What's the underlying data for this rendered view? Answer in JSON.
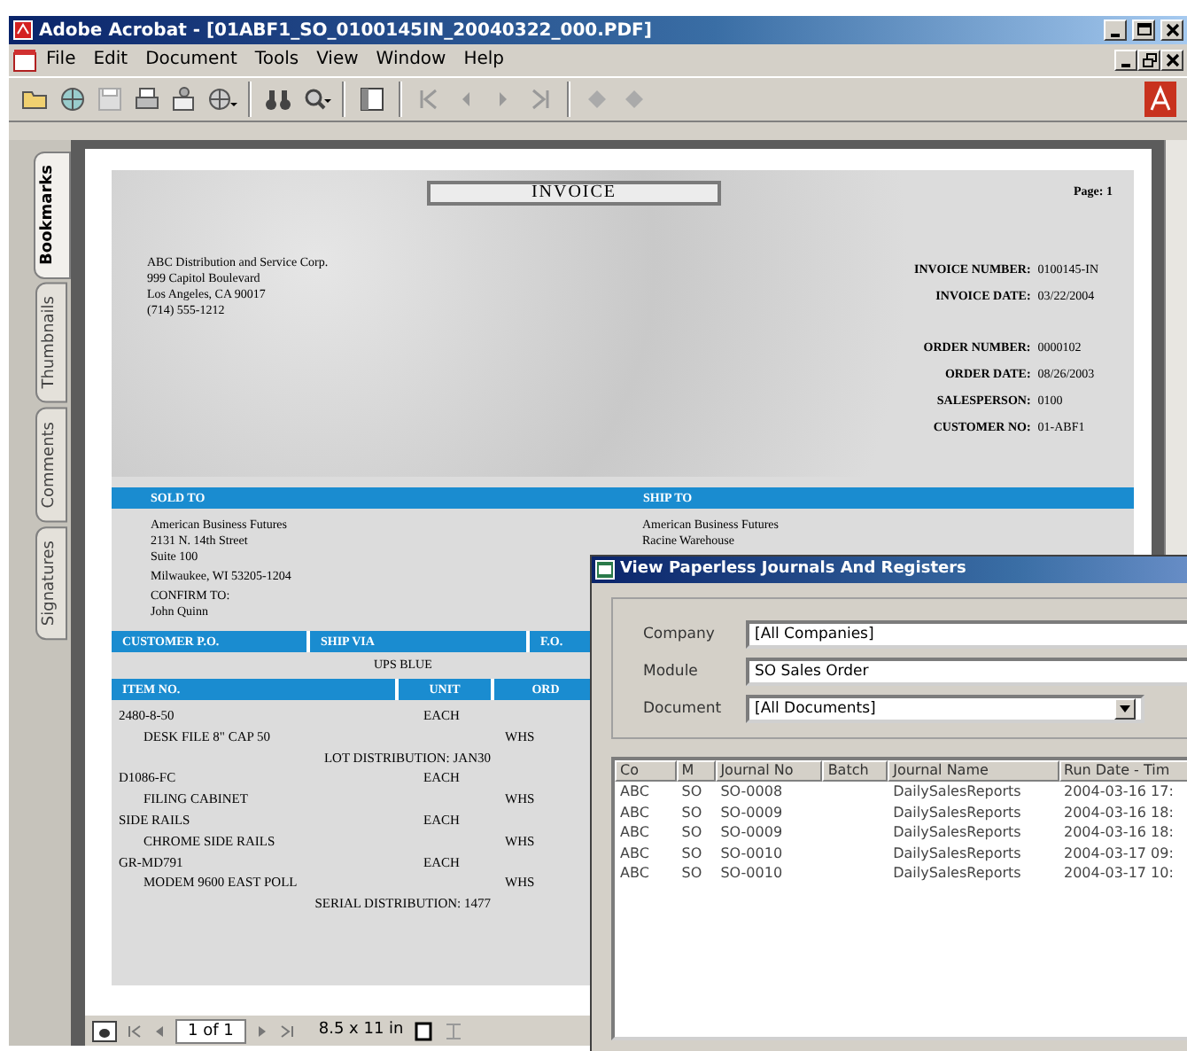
{
  "window": {
    "title": "Adobe Acrobat - [01ABF1_SO_0100145IN_20040322_000.PDF]"
  },
  "menu": [
    "File",
    "Edit",
    "Document",
    "Tools",
    "View",
    "Window",
    "Help"
  ],
  "side_tabs": [
    {
      "label": "Bookmarks",
      "selected": true
    },
    {
      "label": "Thumbnails",
      "selected": false
    },
    {
      "label": "Comments",
      "selected": false
    },
    {
      "label": "Signatures",
      "selected": false
    }
  ],
  "invoice": {
    "title": "INVOICE",
    "page": "Page: 1",
    "company": [
      "ABC Distribution and Service Corp.",
      "999 Capitol Boulevard",
      "Los Angeles, CA 90017",
      "(714) 555-1212"
    ],
    "info": [
      {
        "label": "INVOICE NUMBER:",
        "value": "0100145-IN"
      },
      {
        "label": "INVOICE DATE:",
        "value": "03/22/2004"
      },
      {
        "label": "ORDER NUMBER:",
        "value": "0000102"
      },
      {
        "label": "ORDER DATE:",
        "value": "08/26/2003"
      },
      {
        "label": "SALESPERSON:",
        "value": "0100"
      },
      {
        "label": "CUSTOMER NO:",
        "value": "01-ABF1"
      }
    ],
    "sold_to_heading": "SOLD TO",
    "ship_to_heading": "SHIP TO",
    "sold_to": [
      "American Business Futures",
      "2131 N. 14th Street",
      "Suite 100",
      "Milwaukee,  WI   53205-1204",
      "CONFIRM TO:",
      "John Quinn"
    ],
    "ship_to": [
      "American Business Futures",
      "Racine Warehouse"
    ],
    "order_columns": [
      "CUSTOMER P.O.",
      "SHIP VIA",
      "F.O."
    ],
    "ship_via": "UPS BLUE",
    "item_columns": [
      "ITEM NO.",
      "UNIT",
      "ORD"
    ],
    "items": [
      {
        "kind": "code",
        "text": "2480-8-50",
        "unit": "EACH"
      },
      {
        "kind": "description",
        "text": "DESK FILE 8\" CAP 50",
        "warehouse": "WHS"
      },
      {
        "kind": "distribution",
        "text": "LOT DISTRIBUTION:  JAN30"
      },
      {
        "kind": "code",
        "text": "D1086-FC",
        "unit": "EACH"
      },
      {
        "kind": "description",
        "text": "FILING CABINET",
        "warehouse": "WHS"
      },
      {
        "kind": "code",
        "text": "SIDE RAILS",
        "unit": "EACH"
      },
      {
        "kind": "description",
        "text": "CHROME SIDE RAILS",
        "warehouse": "WHS"
      },
      {
        "kind": "code",
        "text": "GR-MD791",
        "unit": "EACH"
      },
      {
        "kind": "description",
        "text": "MODEM 9600 EAST POLL",
        "warehouse": "WHS"
      },
      {
        "kind": "distribution",
        "text": "SERIAL DISTRIBUTION:  1477"
      }
    ]
  },
  "status_bar": {
    "page": "1 of 1",
    "page_size": "8.5 x 11 in"
  },
  "dialog": {
    "title": "View Paperless Journals And Registers",
    "fields": [
      {
        "label": "Company",
        "value": "[All Companies]",
        "kind": "text"
      },
      {
        "label": "Module",
        "value": "SO  Sales Order",
        "kind": "text"
      },
      {
        "label": "Document",
        "value": "[All Documents]",
        "kind": "dropdown"
      }
    ],
    "table": {
      "columns": [
        "Co",
        "M",
        "Journal No",
        "Batch",
        "Journal Name",
        "Run Date - Tim"
      ],
      "rows": [
        [
          "ABC",
          "SO",
          "SO-0008",
          "",
          "DailySalesReports",
          "2004-03-16  17:"
        ],
        [
          "ABC",
          "SO",
          "SO-0009",
          "",
          "DailySalesReports",
          "2004-03-16  18:"
        ],
        [
          "ABC",
          "SO",
          "SO-0009",
          "",
          "DailySalesReports",
          "2004-03-16  18:"
        ],
        [
          "ABC",
          "SO",
          "SO-0010",
          "",
          "DailySalesReports",
          "2004-03-17  09:"
        ],
        [
          "ABC",
          "SO",
          "SO-0010",
          "",
          "DailySalesReports",
          "2004-03-17  10:"
        ]
      ]
    }
  }
}
